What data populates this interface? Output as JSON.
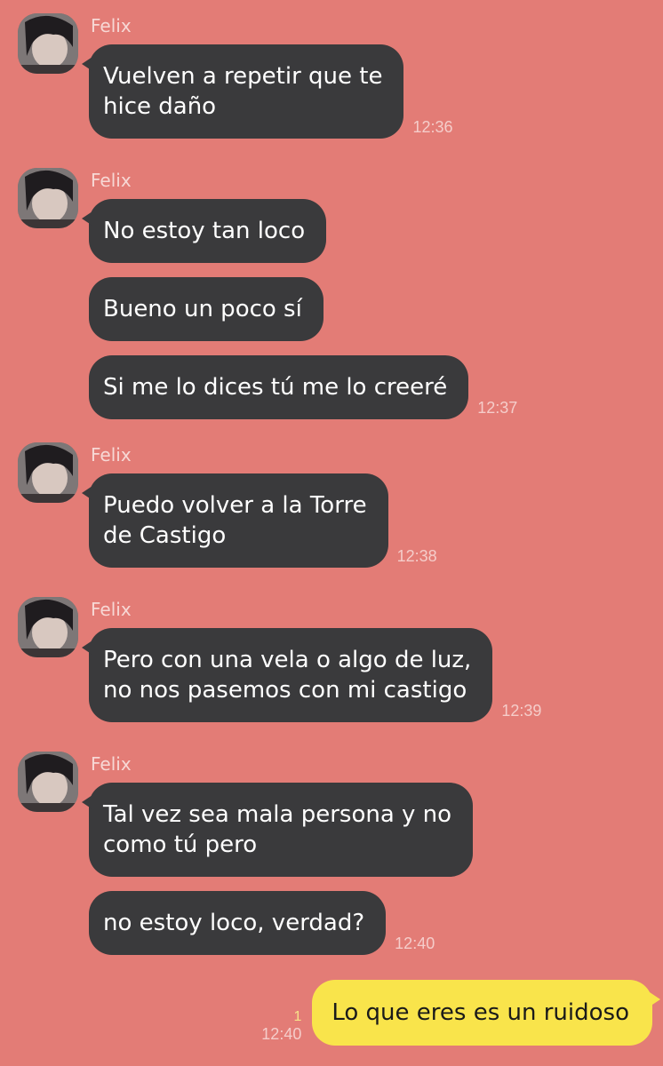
{
  "colors": {
    "background": "#e37c76",
    "incoming_bubble": "#3a3a3c",
    "outgoing_bubble": "#f9e44b"
  },
  "groups": [
    {
      "sender": "Felix",
      "avatar_icon": "profile-photo",
      "messages": [
        "Vuelven a repetir que te\nhice daño"
      ],
      "time": "12:36"
    },
    {
      "sender": "Felix",
      "avatar_icon": "profile-photo",
      "messages": [
        "No estoy tan loco",
        "Bueno un poco sí",
        "Si me lo dices tú me lo creeré"
      ],
      "time": "12:37"
    },
    {
      "sender": "Felix",
      "avatar_icon": "profile-photo",
      "messages": [
        "Puedo volver a la Torre\nde Castigo"
      ],
      "time": "12:38"
    },
    {
      "sender": "Felix",
      "avatar_icon": "profile-photo",
      "messages": [
        "Pero con una vela o algo de luz,\nno nos pasemos con mi castigo"
      ],
      "time": "12:39"
    },
    {
      "sender": "Felix",
      "avatar_icon": "profile-photo",
      "messages": [
        "Tal vez sea mala persona y no\ncomo tú pero",
        "no estoy loco, verdad?"
      ],
      "time": "12:40"
    }
  ],
  "outgoing": {
    "text": "Lo que eres es un ruidoso",
    "read_count": "1",
    "time": "12:40"
  }
}
